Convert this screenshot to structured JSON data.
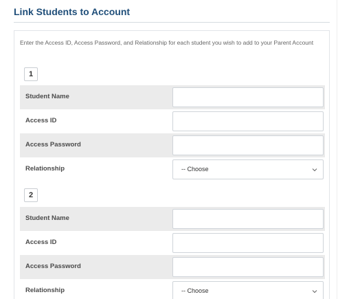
{
  "header": {
    "title": "Link Students to Account"
  },
  "intro": {
    "text": "Enter the Access ID, Access Password, and Relationship for each student you wish to add to your Parent Account"
  },
  "students": [
    {
      "number": "1",
      "fields": {
        "student_name": {
          "label": "Student Name",
          "value": ""
        },
        "access_id": {
          "label": "Access ID",
          "value": ""
        },
        "access_password": {
          "label": "Access Password",
          "value": ""
        },
        "relationship": {
          "label": "Relationship",
          "selected": "-- Choose"
        }
      }
    },
    {
      "number": "2",
      "fields": {
        "student_name": {
          "label": "Student Name",
          "value": ""
        },
        "access_id": {
          "label": "Access ID",
          "value": ""
        },
        "access_password": {
          "label": "Access Password",
          "value": ""
        },
        "relationship": {
          "label": "Relationship",
          "selected": "-- Choose"
        }
      }
    }
  ],
  "icons": {
    "select_arrow": "chevron-down-icon"
  },
  "colors": {
    "title": "#1f4e79",
    "shaded_row": "#ebebeb"
  }
}
